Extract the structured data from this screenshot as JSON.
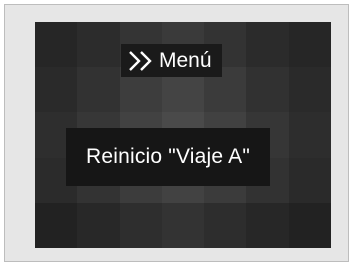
{
  "display": {
    "menu": {
      "icon": "double-chevron-right-icon",
      "label": "Menú"
    },
    "selected_item": {
      "label": "Reinicio \"Viaje A\""
    }
  },
  "colors": {
    "text": "#ffffff",
    "screen_bg": "#2f2f2f",
    "label_bg": "#161616",
    "frame_bg": "#e6e6e6"
  }
}
